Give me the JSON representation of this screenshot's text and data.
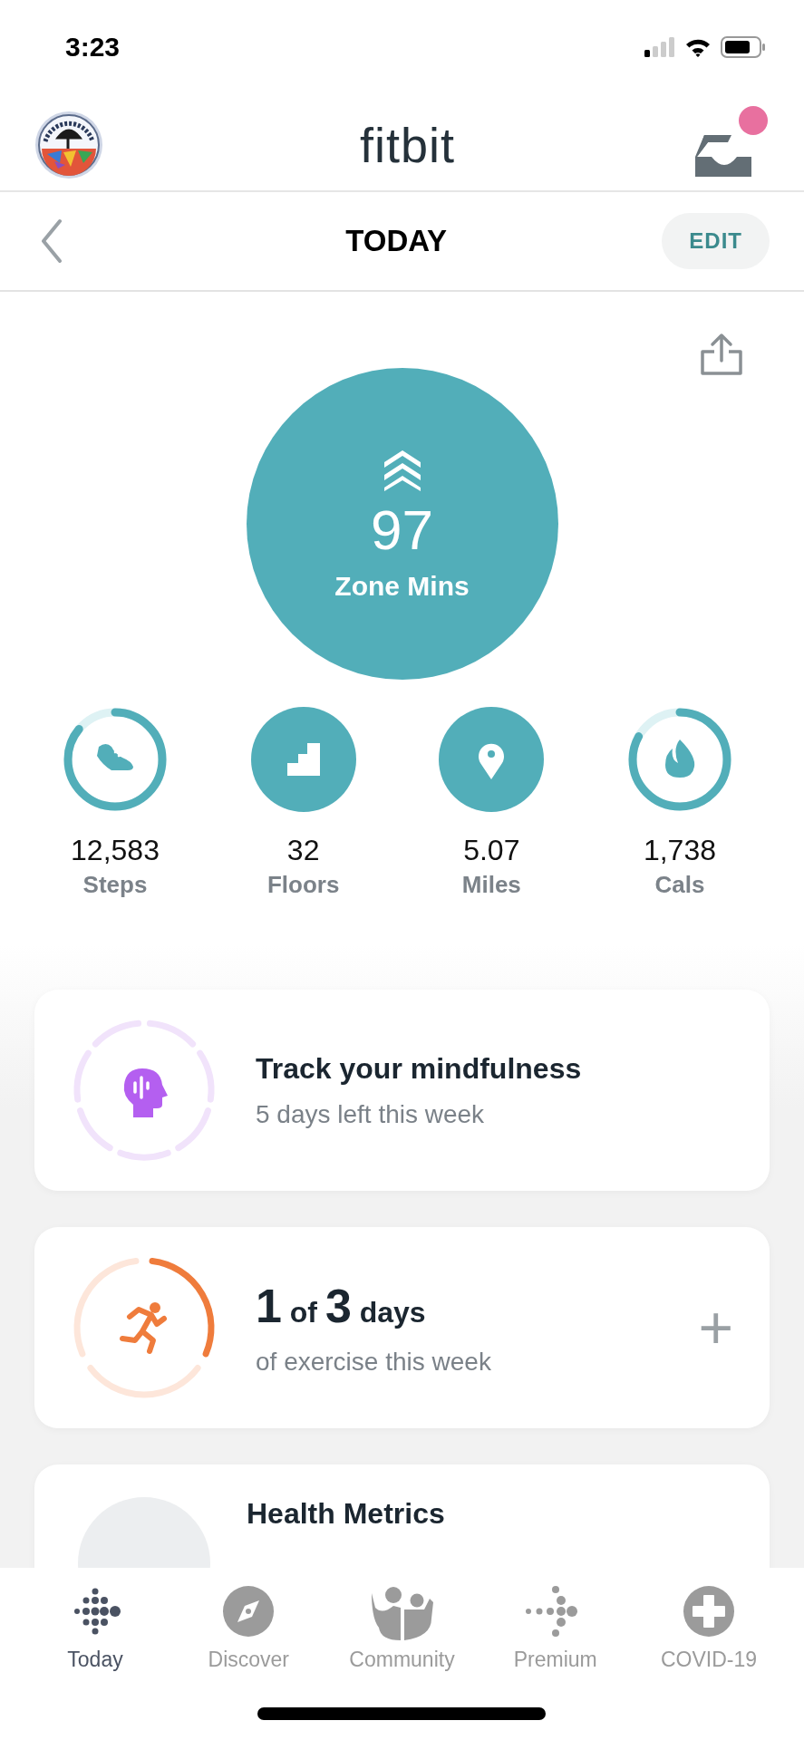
{
  "status_bar": {
    "time": "3:23"
  },
  "header": {
    "logo": "fitbit",
    "inbox": {
      "unread": true
    }
  },
  "day_bar": {
    "title": "TODAY",
    "edit": "EDIT"
  },
  "zone": {
    "value": "97",
    "label": "Zone Mins"
  },
  "stats": [
    {
      "kind": "ring",
      "level": 0.86,
      "value": "12,583",
      "label": "Steps"
    },
    {
      "kind": "solid",
      "value": "32",
      "label": "Floors"
    },
    {
      "kind": "solid",
      "value": "5.07",
      "label": "Miles"
    },
    {
      "kind": "ring",
      "level": 0.83,
      "value": "1,738",
      "label": "Cals"
    }
  ],
  "cards": [
    {
      "kind": "mindfulness",
      "title": [
        {
          "text": "Track your mindfulness",
          "big": false
        }
      ],
      "subtitle": "5 days left this week"
    },
    {
      "kind": "exercise",
      "title": [
        {
          "text": "1",
          "big": true
        },
        {
          "text": "of",
          "big": false
        },
        {
          "text": "3",
          "big": true
        },
        {
          "text": "days",
          "big": false
        }
      ],
      "subtitle": "of exercise this week",
      "action": "+"
    },
    {
      "kind": "metrics",
      "title": [
        {
          "text": "Health Metrics",
          "big": false
        }
      ]
    }
  ],
  "nav": [
    {
      "label": "Today",
      "selected": true
    },
    {
      "label": "Discover",
      "selected": false
    },
    {
      "label": "Community",
      "selected": false
    },
    {
      "label": "Premium",
      "selected": false
    },
    {
      "label": "COVID-19",
      "selected": false
    }
  ]
}
